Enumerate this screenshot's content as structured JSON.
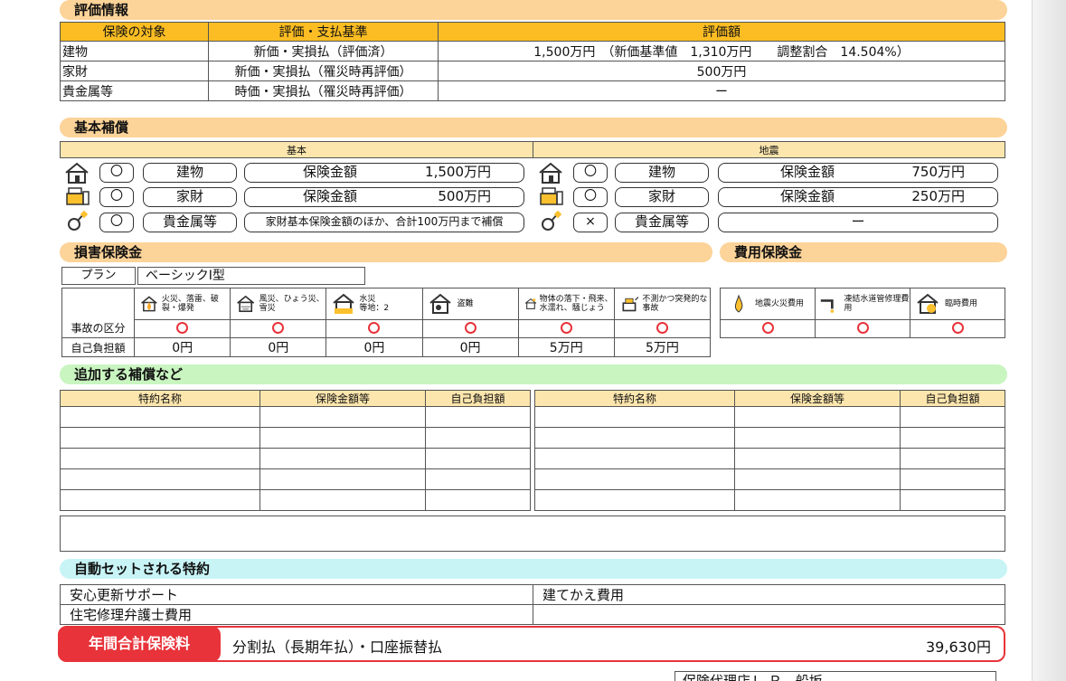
{
  "eval": {
    "title": "評価情報",
    "headers": [
      "保険の対象",
      "評価・支払基準",
      "評価額"
    ],
    "rows": [
      {
        "target": "建物",
        "basis": "新価・実損払（評価済）",
        "amount": "1,500万円　（新価基準値　1,310万円　　調整割合　14.504%）"
      },
      {
        "target": "家財",
        "basis": "新価・実損払（罹災時再評価）",
        "amount": "500万円"
      },
      {
        "target": "貴金属等",
        "basis": "時価・実損払（罹災時再評価）",
        "amount": "ー"
      }
    ]
  },
  "basic": {
    "title": "基本補償",
    "col_basic": "基本",
    "col_quake": "地震",
    "basic_rows": [
      {
        "mark": "〇",
        "item": "建物",
        "label": "保険金額",
        "value": "1,500万円"
      },
      {
        "mark": "〇",
        "item": "家財",
        "label": "保険金額",
        "value": "500万円"
      },
      {
        "mark": "〇",
        "item": "貴金属等",
        "text": "家財基本保険金額のほか、合計100万円まで補償"
      }
    ],
    "quake_rows": [
      {
        "mark": "〇",
        "item": "建物",
        "label": "保険金額",
        "value": "750万円"
      },
      {
        "mark": "〇",
        "item": "家財",
        "label": "保険金額",
        "value": "250万円"
      },
      {
        "mark": "×",
        "item": "貴金属等",
        "text": "ー"
      }
    ]
  },
  "damage": {
    "title": "損害保険金",
    "plan_label": "プラン",
    "plan_value": "ベーシックⅠ型",
    "row_accident": "事故の区分",
    "row_deductible": "自己負担額",
    "categories": [
      {
        "label": "火災、落雷、破裂・爆発",
        "icon": "fire-house-icon",
        "deductible": "0円"
      },
      {
        "label": "風災、ひょう災、雪災",
        "icon": "wind-house-icon",
        "deductible": "0円"
      },
      {
        "label": "水災\n等地：2",
        "icon": "flood-house-icon",
        "deductible": "0円"
      },
      {
        "label": "盗難",
        "icon": "theft-house-icon",
        "deductible": "0円"
      },
      {
        "label": "物体の落下・飛来、水濡れ、騒じょう",
        "icon": "falling-object-icon",
        "deductible": "5万円"
      },
      {
        "label": "不測かつ突発的な事故",
        "icon": "accident-icon",
        "deductible": "5万円"
      }
    ]
  },
  "expense": {
    "title": "費用保険金",
    "items": [
      {
        "label": "地震火災費用",
        "icon": "quake-fire-icon"
      },
      {
        "label": "凍結水道管修理費用",
        "icon": "frozen-pipe-icon"
      },
      {
        "label": "臨時費用",
        "icon": "temporary-cost-icon"
      }
    ]
  },
  "additional": {
    "title": "追加する補償など",
    "headers": [
      "特約名称",
      "保険金額等",
      "自己負担額"
    ]
  },
  "auto": {
    "title": "自動セットされる特約",
    "left": [
      "安心更新サポート",
      "住宅修理弁護士費用"
    ],
    "right": [
      "建てかえ費用",
      ""
    ]
  },
  "premium": {
    "label": "年間合計保険料",
    "method": "分割払（長期年払）・口座振替払",
    "amount": "39,630円"
  },
  "footer": {
    "agency": "保険代理店Ｌ.Ｒ　船坂"
  },
  "colors": {
    "header_yellow": "#fbbd23",
    "section_orange": "#fcd398",
    "section_green": "#c9f5c0",
    "section_cyan": "#c8f4f6",
    "accent_red": "#e8333a"
  }
}
